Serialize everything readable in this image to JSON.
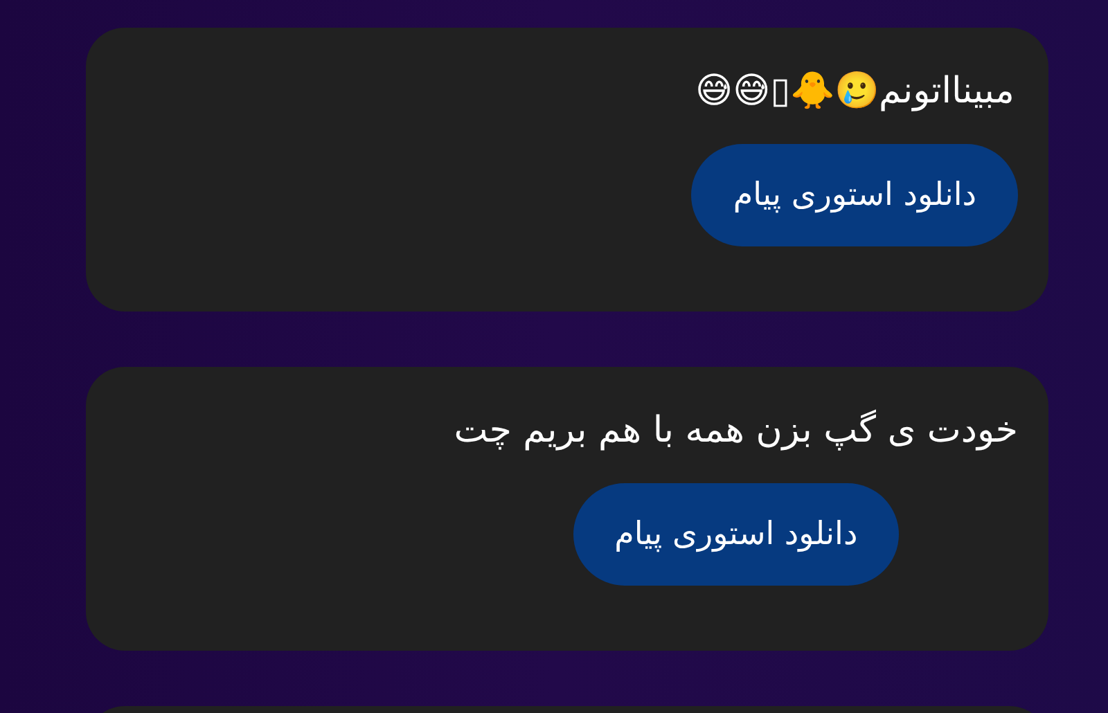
{
  "messages": [
    {
      "text": "مبینااتونم🥲🐥▯😅😅",
      "button": "دانلود استوری پیام"
    },
    {
      "text": "خودت ی گپ بزن همه با هم بریم چت",
      "button": "دانلود استوری پیام"
    }
  ]
}
